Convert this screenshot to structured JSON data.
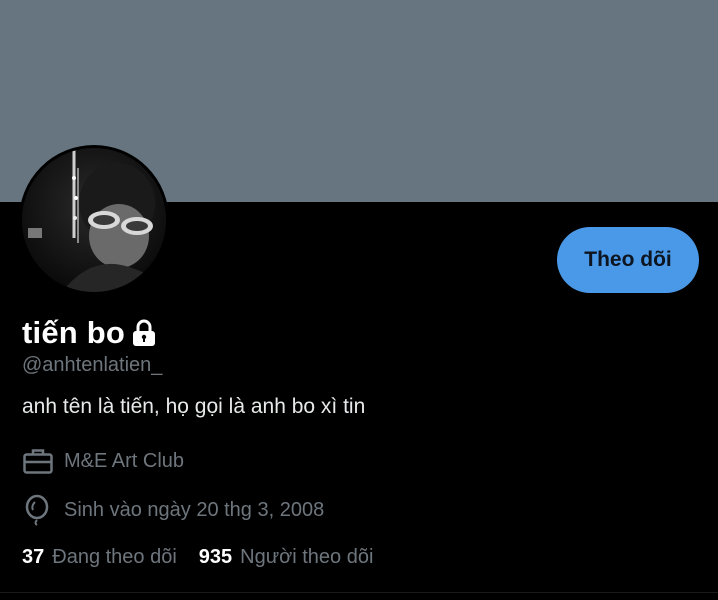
{
  "profile": {
    "display_name": "tiến bo",
    "handle": "@anhtenlatien_",
    "bio": "anh tên là tiến, họ gọi là anh bo xì tin",
    "work": "M&E Art Club",
    "birthday": "Sinh vào ngày 20 thg 3, 2008",
    "follow_button": "Theo dõi"
  },
  "stats": {
    "following_count": "37",
    "following_label": "Đang theo dõi",
    "followers_count": "935",
    "followers_label": "Người theo dõi"
  },
  "icons": {
    "lock": "lock-icon",
    "work": "briefcase-icon",
    "birthday": "balloon-icon"
  },
  "colors": {
    "banner": "#66757f",
    "accent": "#4a99e9",
    "background": "#000000",
    "secondary_text": "#6e767d"
  }
}
